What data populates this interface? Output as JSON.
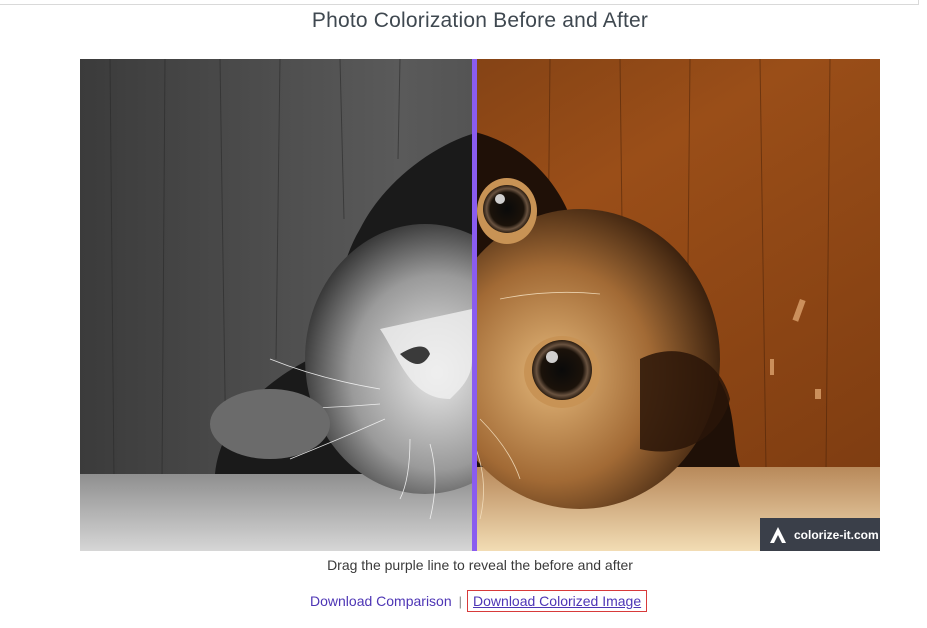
{
  "page": {
    "title": "Photo Colorization Before and After"
  },
  "comparison": {
    "watermark": "colorize-it.com",
    "divider_color": "#8a5cf0",
    "divider_position_fraction": 0.49
  },
  "hint": "Drag the purple line to reveal the before and after",
  "links": {
    "download_comparison": "Download Comparison",
    "separator": "|",
    "download_colorized": "Download Colorized Image"
  },
  "colors": {
    "link": "#4d35b5",
    "highlight_border": "#d83a3a",
    "watermark_bg": "#3a3f49"
  }
}
